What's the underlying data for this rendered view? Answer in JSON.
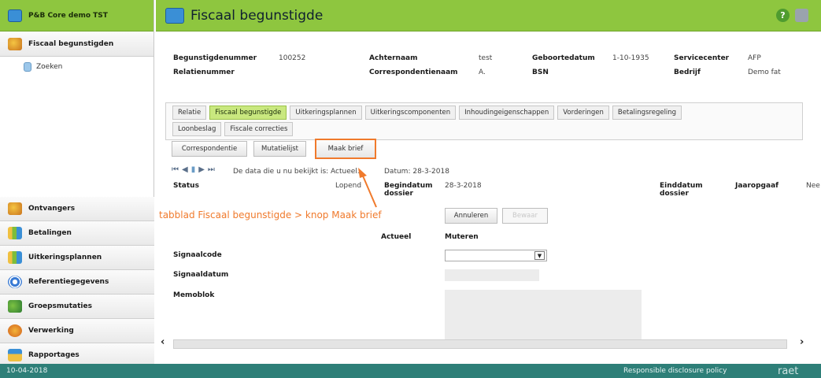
{
  "sidebar": {
    "app_label": "P&B Core demo TST",
    "top_section": "Fiscaal begunstigden",
    "sub_item": "Zoeken",
    "sections": [
      "Ontvangers",
      "Betalingen",
      "Uitkeringsplannen",
      "Referentiegegevens",
      "Groepsmutaties",
      "Verwerking",
      "Rapportages"
    ]
  },
  "header": {
    "title": "Fiscaal begunstigde"
  },
  "info": {
    "begunstigdenummer_label": "Begunstigdenummer",
    "begunstigdenummer": "100252",
    "achternaam_label": "Achternaam",
    "achternaam": "test",
    "geboortedatum_label": "Geboortedatum",
    "geboortedatum": "1-10-1935",
    "servicecenter_label": "Servicecenter",
    "servicecenter": "AFP",
    "relatienummer_label": "Relatienummer",
    "correspondentienaam_label": "Correspondentienaam",
    "correspondentienaam": "A.",
    "bsn_label": "BSN",
    "bedrijf_label": "Bedrijf",
    "bedrijf": "Demo fat"
  },
  "tabs": {
    "row1": [
      "Relatie",
      "Fiscaal begunstigde",
      "Uitkeringsplannen",
      "Uitkeringscomponenten",
      "Inhoudingeigenschappen",
      "Vorderingen",
      "Betalingsregeling"
    ],
    "row2": [
      "Loonbeslag",
      "Fiscale correcties"
    ],
    "active": "Fiscaal begunstigde"
  },
  "actions": {
    "correspondentie": "Correspondentie",
    "mutatielijst": "Mutatielijst",
    "maak_brief": "Maak brief"
  },
  "nav": {
    "data_text": "De data die u nu bekijkt is: Actueel.",
    "datum_text": "Datum: 28-3-2018"
  },
  "dossier": {
    "status_label": "Status",
    "status": "Lopend",
    "begindatum_label": "Begindatum dossier",
    "begindatum": "28-3-2018",
    "einddatum_label": "Einddatum dossier",
    "jaaropgaaf_label": "Jaaropgaaf",
    "jaaropgaaf": "Nee"
  },
  "annotation": {
    "text": "tabblad Fiscaal begunstigde > knop Maak brief",
    "color": "#f07a2c"
  },
  "form": {
    "annuleren": "Annuleren",
    "bewaar": "Bewaar",
    "actueel_header": "Actueel",
    "muteren_header": "Muteren",
    "signaalcode_label": "Signaalcode",
    "signaaldatum_label": "Signaaldatum",
    "memoblok_label": "Memoblok"
  },
  "status_bar": {
    "date": "10-04-2018",
    "link": "Responsible disclosure policy",
    "brand": "raet"
  },
  "colors": {
    "green": "#8ec63f",
    "status_bar": "#2e7f78",
    "active_tab": "#c9e87f",
    "annotation": "#f07a2c"
  }
}
